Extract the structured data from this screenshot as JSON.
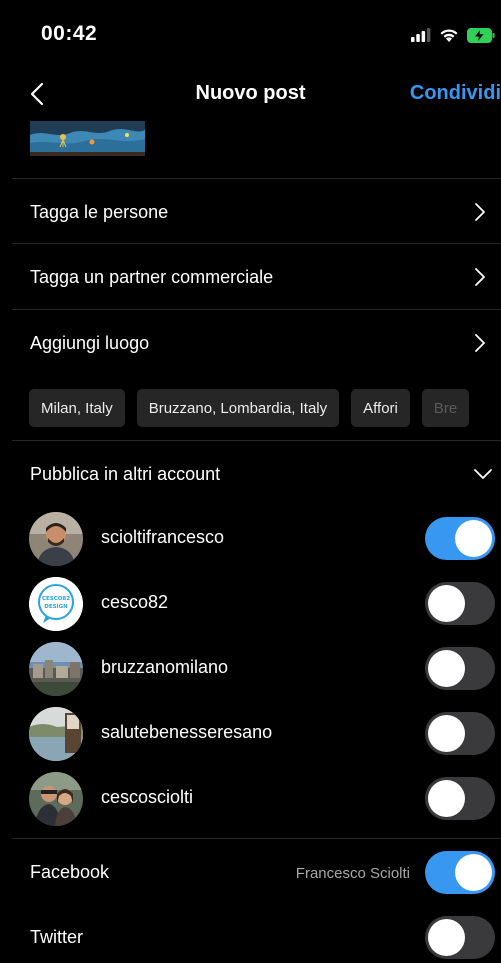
{
  "status_bar": {
    "time": "00:42",
    "icons": [
      "signal-icon",
      "wifi-icon",
      "battery-charging-icon"
    ],
    "battery_color": "#30d158"
  },
  "nav": {
    "title": "Nuovo post",
    "share_label": "Condividi",
    "accent_color": "#3897f0"
  },
  "options": [
    {
      "label": "Tagga le persone"
    },
    {
      "label": "Tagga un partner commerciale"
    },
    {
      "label": "Aggiungi luogo"
    }
  ],
  "location_suggestions": [
    "Milan, Italy",
    "Bruzzano, Lombardia, Italy",
    "Affori",
    "Bre"
  ],
  "other_accounts": {
    "header": "Pubblica in altri account",
    "accounts": [
      {
        "username": "scioltifrancesco",
        "enabled": true
      },
      {
        "username": "cesco82",
        "enabled": false
      },
      {
        "username": "bruzzanomilano",
        "enabled": false
      },
      {
        "username": "salutebenesseresano",
        "enabled": false
      },
      {
        "username": "cescosciolti",
        "enabled": false
      }
    ]
  },
  "facebook": {
    "label": "Facebook",
    "account": "Francesco Sciolti",
    "enabled": true
  },
  "twitter": {
    "label": "Twitter",
    "enabled": false
  },
  "avatar_logo_text": "CESCO82 DESIGN"
}
